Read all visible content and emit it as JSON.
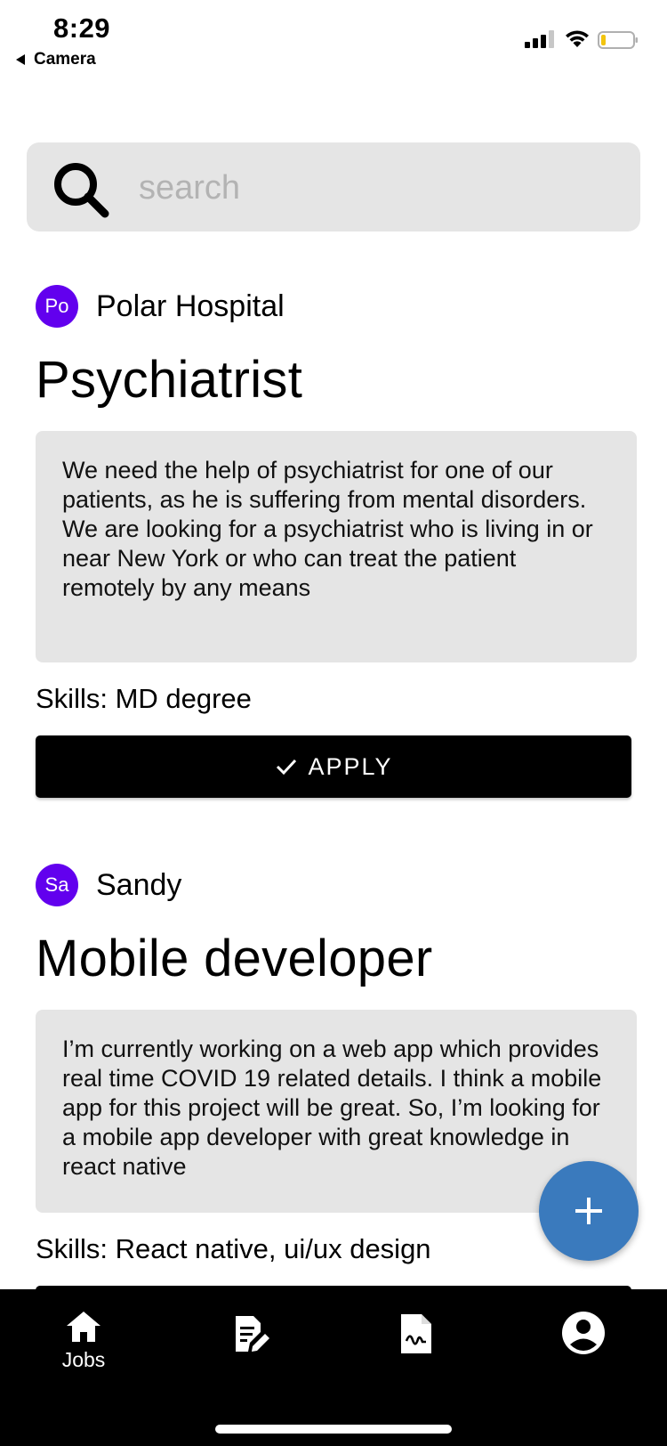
{
  "status_bar": {
    "time": "8:29",
    "back_label": "Camera"
  },
  "search": {
    "placeholder": "search"
  },
  "jobs": [
    {
      "avatar_initials": "Po",
      "poster": "Polar Hospital",
      "title": "Psychiatrist",
      "description": "We need the help of psychiatrist for one of our patients, as he is suffering from mental disorders. We are looking for a psychiatrist who is living in or near New York or who can treat the patient remotely by any means",
      "skills": "Skills: MD degree",
      "apply_label": "APPLY"
    },
    {
      "avatar_initials": "Sa",
      "poster": "Sandy",
      "title": "Mobile developer",
      "description": "I’m currently working on a web app which provides real time COVID 19 related details. I think a mobile app for this project will be great. So, I’m looking for a mobile app developer with great knowledge in react native",
      "skills": "Skills: React native, ui/ux design"
    }
  ],
  "fab": {
    "icon": "plus-icon"
  },
  "bottom_nav": {
    "items": [
      {
        "icon": "home-icon",
        "label": "Jobs"
      },
      {
        "icon": "edit-note-icon"
      },
      {
        "icon": "signed-document-icon"
      },
      {
        "icon": "account-icon"
      }
    ]
  },
  "colors": {
    "avatar": "#6200ee",
    "fab": "#3a7abd",
    "search_bg": "#e5e5e5",
    "nav_bg": "#000000"
  }
}
